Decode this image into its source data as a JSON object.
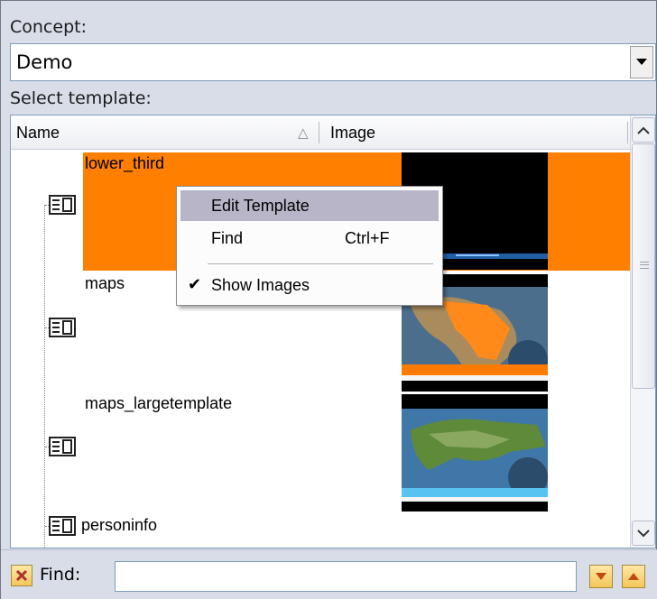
{
  "concept": {
    "label": "Concept:",
    "value": "Demo"
  },
  "select_template": {
    "label": "Select template:"
  },
  "grid": {
    "columns": [
      {
        "label": "Name",
        "sorted": "ascending"
      },
      {
        "label": "Image"
      }
    ],
    "rows": [
      {
        "name": "lower_third",
        "selected": true
      },
      {
        "name": "maps",
        "selected": false
      },
      {
        "name": "maps_largetemplate",
        "selected": false
      },
      {
        "name": "personinfo",
        "selected": false
      }
    ]
  },
  "context_menu": {
    "items": [
      {
        "label": "Edit Template",
        "shortcut": "",
        "highlighted": true
      },
      {
        "label": "Find",
        "shortcut": "Ctrl+F"
      },
      {
        "label": "Show Images",
        "checked": true
      }
    ]
  },
  "find": {
    "label": "Find:",
    "value": ""
  },
  "colors": {
    "selection": "#ff8000",
    "menu_highlight": "#b8b5c8",
    "panel": "#d8dde8"
  }
}
